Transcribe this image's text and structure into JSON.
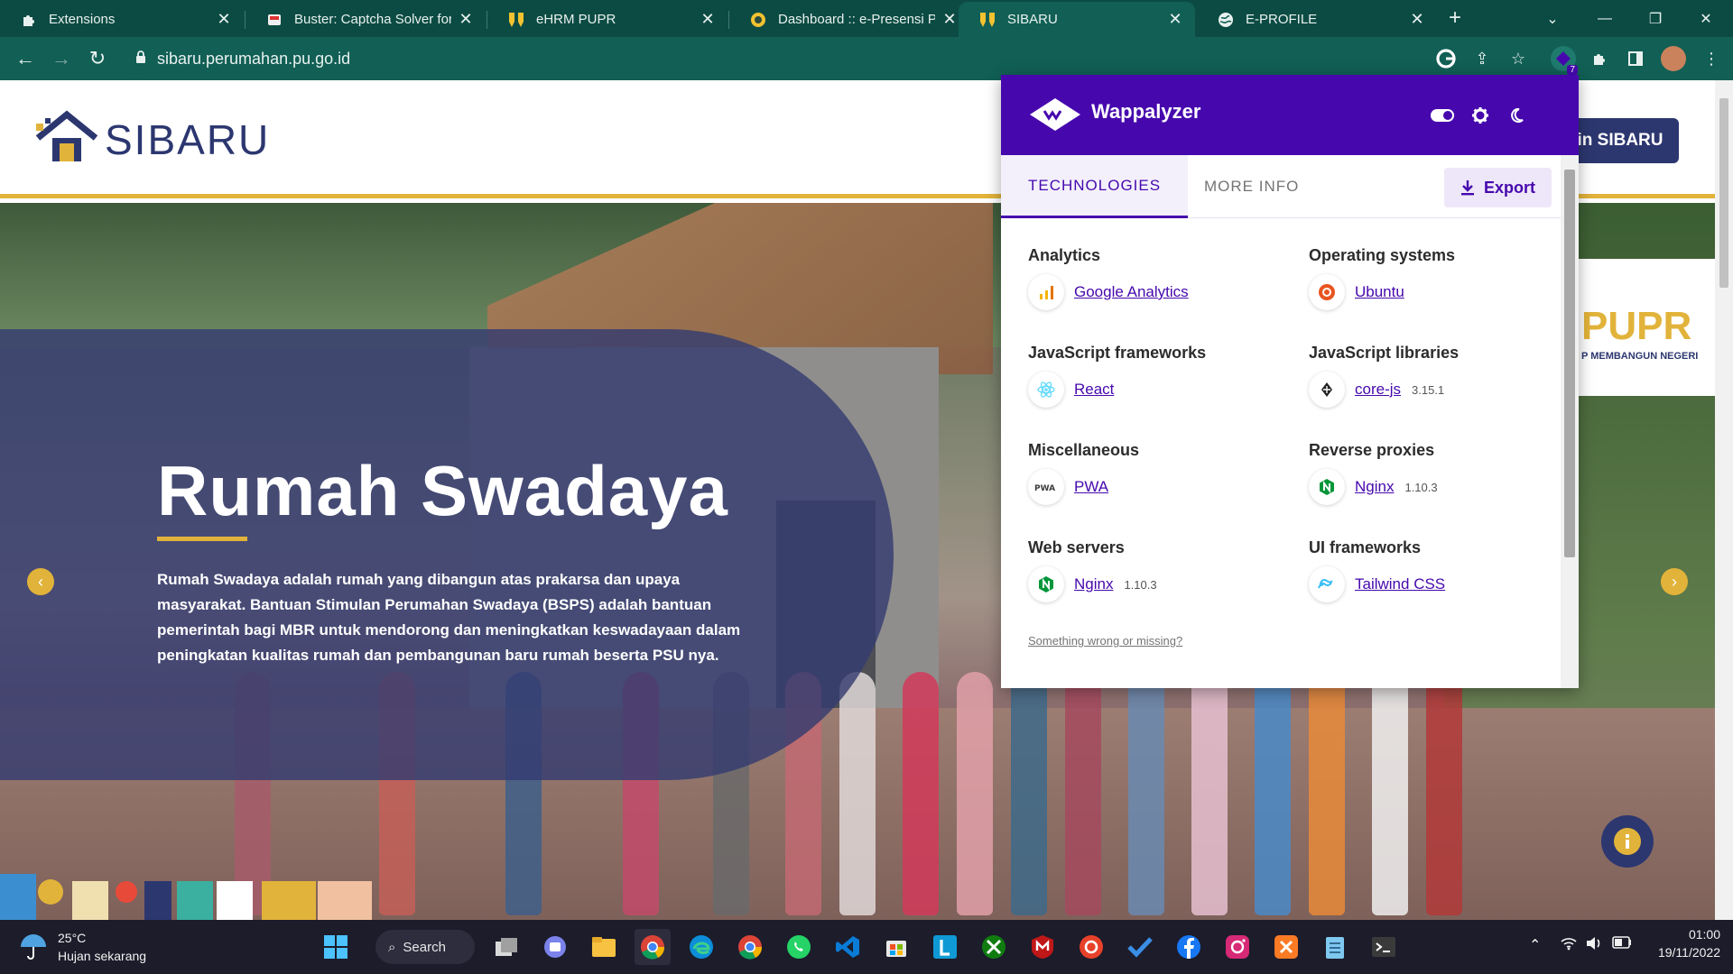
{
  "browser": {
    "tabs": [
      {
        "title": "Extensions",
        "icon": "puzzle-icon",
        "active": false
      },
      {
        "title": "Buster: Captcha Solver for H",
        "icon": "buster-icon",
        "active": false
      },
      {
        "title": "eHRM PUPR",
        "icon": "pupr-icon",
        "active": false
      },
      {
        "title": "Dashboard :: e-Presensi PUP",
        "icon": "presensi-icon",
        "active": false
      },
      {
        "title": "SIBARU",
        "icon": "pupr-icon",
        "active": true
      },
      {
        "title": "E-PROFILE",
        "icon": "globe-icon",
        "active": false
      }
    ],
    "url": "sibaru.perumahan.pu.go.id",
    "extension_badge": "7"
  },
  "site": {
    "brand": "SIBARU",
    "login_label": "in SIBARU",
    "pupr_text": "PUPR",
    "pupr_sub": "P MEMBANGUN NEGERI",
    "hero": {
      "title": "Rumah Swadaya",
      "text": "Rumah Swadaya adalah rumah yang dibangun atas prakarsa dan upaya masyarakat. Bantuan Stimulan Perumahan Swadaya (BSPS) adalah bantuan pemerintah bagi MBR untuk mendorong dan meningkatkan keswadayaan dalam peningkatan kualitas rumah dan pembangunan baru rumah beserta PSU nya."
    }
  },
  "wappalyzer": {
    "name": "Wappalyzer",
    "tabs": {
      "technologies": "TECHNOLOGIES",
      "more_info": "MORE INFO"
    },
    "export_label": "Export",
    "categories": [
      {
        "name": "Analytics",
        "tech": "Google Analytics",
        "version": "",
        "icon": "google-analytics-icon"
      },
      {
        "name": "Operating systems",
        "tech": "Ubuntu",
        "version": "",
        "icon": "ubuntu-icon"
      },
      {
        "name": "JavaScript frameworks",
        "tech": "React",
        "version": "",
        "icon": "react-icon"
      },
      {
        "name": "JavaScript libraries",
        "tech": "core-js",
        "version": "3.15.1",
        "icon": "core-js-icon"
      },
      {
        "name": "Miscellaneous",
        "tech": "PWA",
        "version": "",
        "icon": "pwa-icon"
      },
      {
        "name": "Reverse proxies",
        "tech": "Nginx",
        "version": "1.10.3",
        "icon": "nginx-icon"
      },
      {
        "name": "Web servers",
        "tech": "Nginx",
        "version": "1.10.3",
        "icon": "nginx-icon"
      },
      {
        "name": "UI frameworks",
        "tech": "Tailwind CSS",
        "version": "",
        "icon": "tailwind-icon"
      }
    ],
    "footer_link": "Something wrong or missing?"
  },
  "taskbar": {
    "weather_temp": "25°C",
    "weather_desc": "Hujan sekarang",
    "search_label": "Search",
    "time": "01:00",
    "date": "19/11/2022"
  },
  "colors": {
    "chrome_frame": "#0c4b43",
    "chrome_toolbar": "#115f55",
    "wappalyzer_purple": "#4608ad",
    "sibaru_navy": "#2c3770",
    "sibaru_gold": "#e2b33a"
  }
}
